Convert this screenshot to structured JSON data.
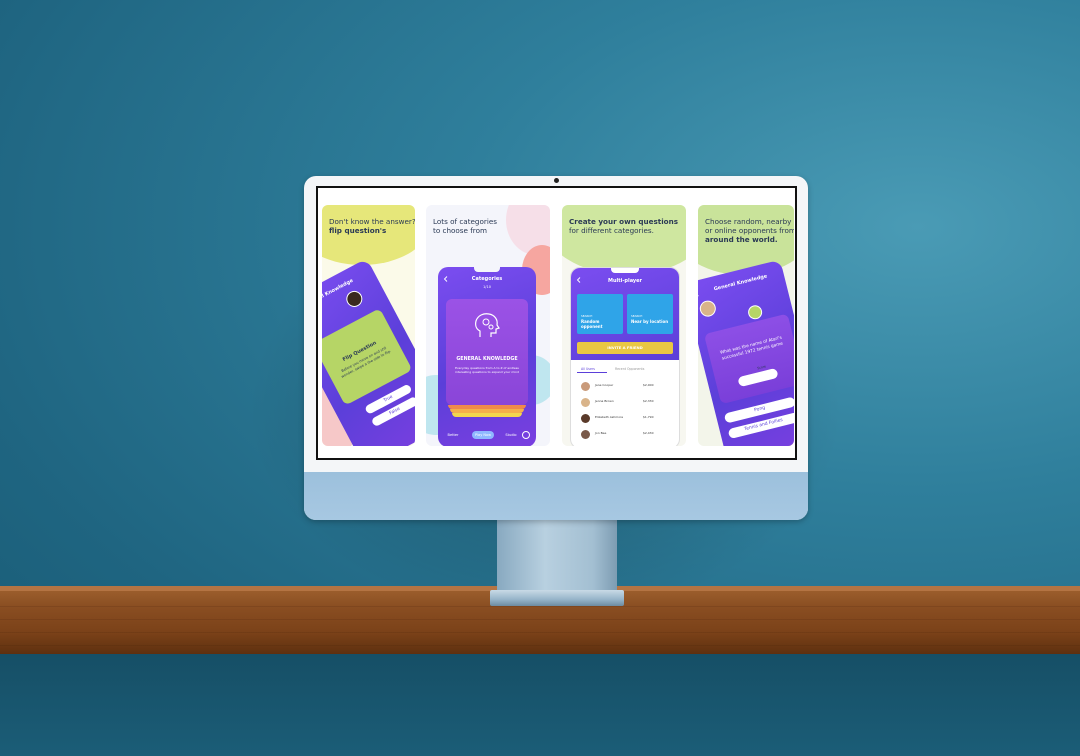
{
  "panels": [
    {
      "heading_line1": "Don't know the answer?",
      "heading_line2": "flip question's",
      "phone_title": "General Knowledge",
      "card_title": "Flip Question",
      "card_body": "Before you move on and still wonder, swipe a the side to flip.",
      "options": [
        "True",
        "False"
      ]
    },
    {
      "heading_line1": "Lots of categories",
      "heading_line2": "to choose from",
      "phone_title": "Categories",
      "phone_subtitle": "1/10",
      "card_title": "GENERAL KNOWLEDGE",
      "card_body": "Everyday questions from A to Z of endless interesting questions to expand your mind",
      "footer_left": "Better",
      "footer_mid": "Play Now",
      "footer_right": "Studio"
    },
    {
      "heading_line1": "Create your own questions",
      "heading_line2": "for different categories.",
      "phone_title": "Multi-player",
      "tile1_small": "SEARCH",
      "tile1_label": "Random opponent",
      "tile2_small": "SEARCH",
      "tile2_label": "Near by location",
      "invite_label": "INVITE A FRIEND",
      "tabs": [
        "All Users",
        "Recent Opponents"
      ],
      "players": [
        {
          "name": "Jane Cooper",
          "stat": "$2,000"
        },
        {
          "name": "Jenna Brown",
          "stat": "$2,330"
        },
        {
          "name": "Elizabeth Ashmore",
          "stat": "$1,790"
        },
        {
          "name": "Jon Bee",
          "stat": "$2,430"
        }
      ]
    },
    {
      "heading_line1": "Choose random, nearby",
      "heading_line2": "or online opponents from",
      "heading_line3": "around the world.",
      "phone_title": "General Knowledge",
      "question": "What was the name of Atari's successful 1972 tennis game",
      "answer_title": "Score",
      "options": [
        "Pong",
        "Tennis and Follies"
      ]
    }
  ],
  "colors": {
    "wall": "#2f7f9c",
    "shelf": "#8a4e22",
    "imac_chin": "#a3c5e0",
    "phone_purple": "#6a45e6",
    "accent_yellow": "#e9c743",
    "accent_green": "#b8d66a",
    "tile_blue": "#2fa4e8"
  },
  "icons": [
    "back-arrow-icon",
    "brain-gears-icon",
    "search-icon",
    "avatar-icon",
    "timer-icon"
  ]
}
